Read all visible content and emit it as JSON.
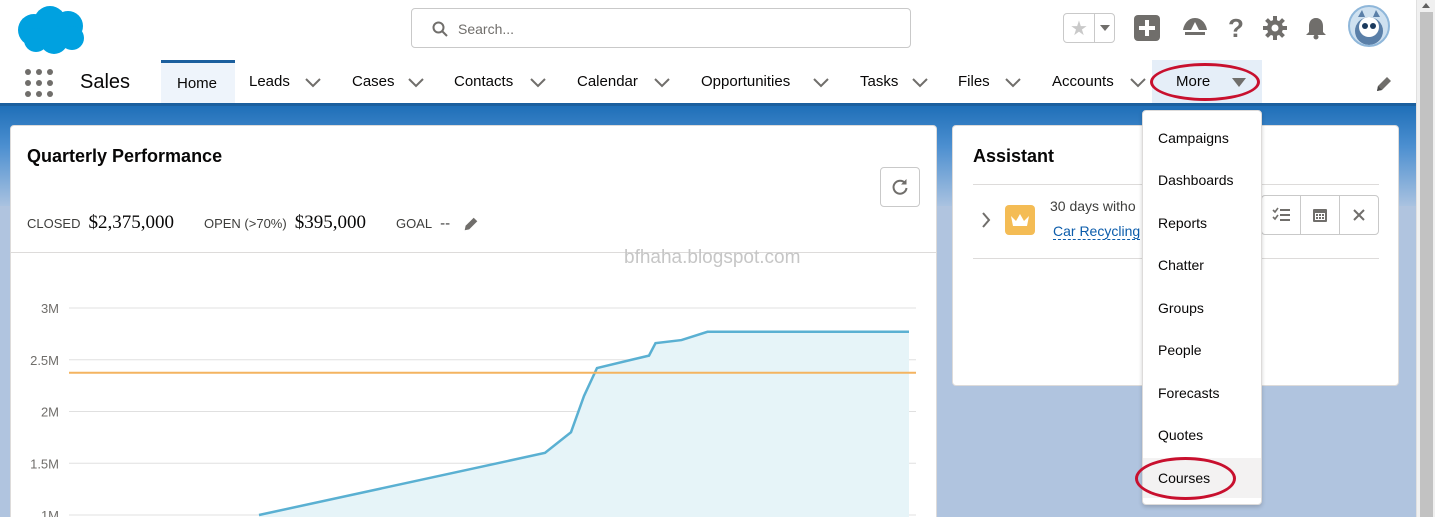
{
  "header": {
    "search_placeholder": "Search...",
    "icons": [
      "salesforce-cloud-logo",
      "favorites-star-icon",
      "add-icon",
      "trailhead-icon",
      "help-icon",
      "setup-gear-icon",
      "notifications-bell-icon",
      "user-avatar"
    ]
  },
  "nav": {
    "app_name": "Sales",
    "items": [
      {
        "label": "Home"
      },
      {
        "label": "Leads"
      },
      {
        "label": "Cases"
      },
      {
        "label": "Contacts"
      },
      {
        "label": "Calendar"
      },
      {
        "label": "Opportunities"
      },
      {
        "label": "Tasks"
      },
      {
        "label": "Files"
      },
      {
        "label": "Accounts"
      },
      {
        "label": "More"
      }
    ]
  },
  "more_menu": {
    "items": [
      "Campaigns",
      "Dashboards",
      "Reports",
      "Chatter",
      "Groups",
      "People",
      "Forecasts",
      "Quotes",
      "Courses"
    ]
  },
  "performance": {
    "title": "Quarterly Performance",
    "closed_label": "CLOSED",
    "closed_value": "$2,375,000",
    "open_label": "OPEN (>70%)",
    "open_value": "$395,000",
    "goal_label": "GOAL",
    "goal_value": "--"
  },
  "assistant": {
    "title": "Assistant",
    "item_text": "30 days witho",
    "item_link": "Car Recycling"
  },
  "watermark": "bfhaha.blogspot.com",
  "colors": {
    "brand_blue": "#1b5f9e",
    "chart_line": "#5ab0d2",
    "chart_fill": "#e6f4f8",
    "goal_line": "#f4b460",
    "annotation_red": "#c8102e"
  },
  "chart_data": {
    "type": "area",
    "y_tick_labels": [
      "3M",
      "2.5M",
      "2M",
      "1.5M",
      "1M"
    ],
    "ylim": [
      1000000,
      3000000
    ],
    "goal": 2375000,
    "series": [
      {
        "values": [
          [
            0.0,
            1000000
          ],
          [
            0.44,
            1600000
          ],
          [
            0.48,
            1800000
          ],
          [
            0.5,
            2150000
          ],
          [
            0.52,
            2420000
          ],
          [
            0.6,
            2540000
          ],
          [
            0.61,
            2660000
          ],
          [
            0.65,
            2690000
          ],
          [
            0.69,
            2770000
          ],
          [
            1.0,
            2770000
          ]
        ]
      }
    ]
  }
}
